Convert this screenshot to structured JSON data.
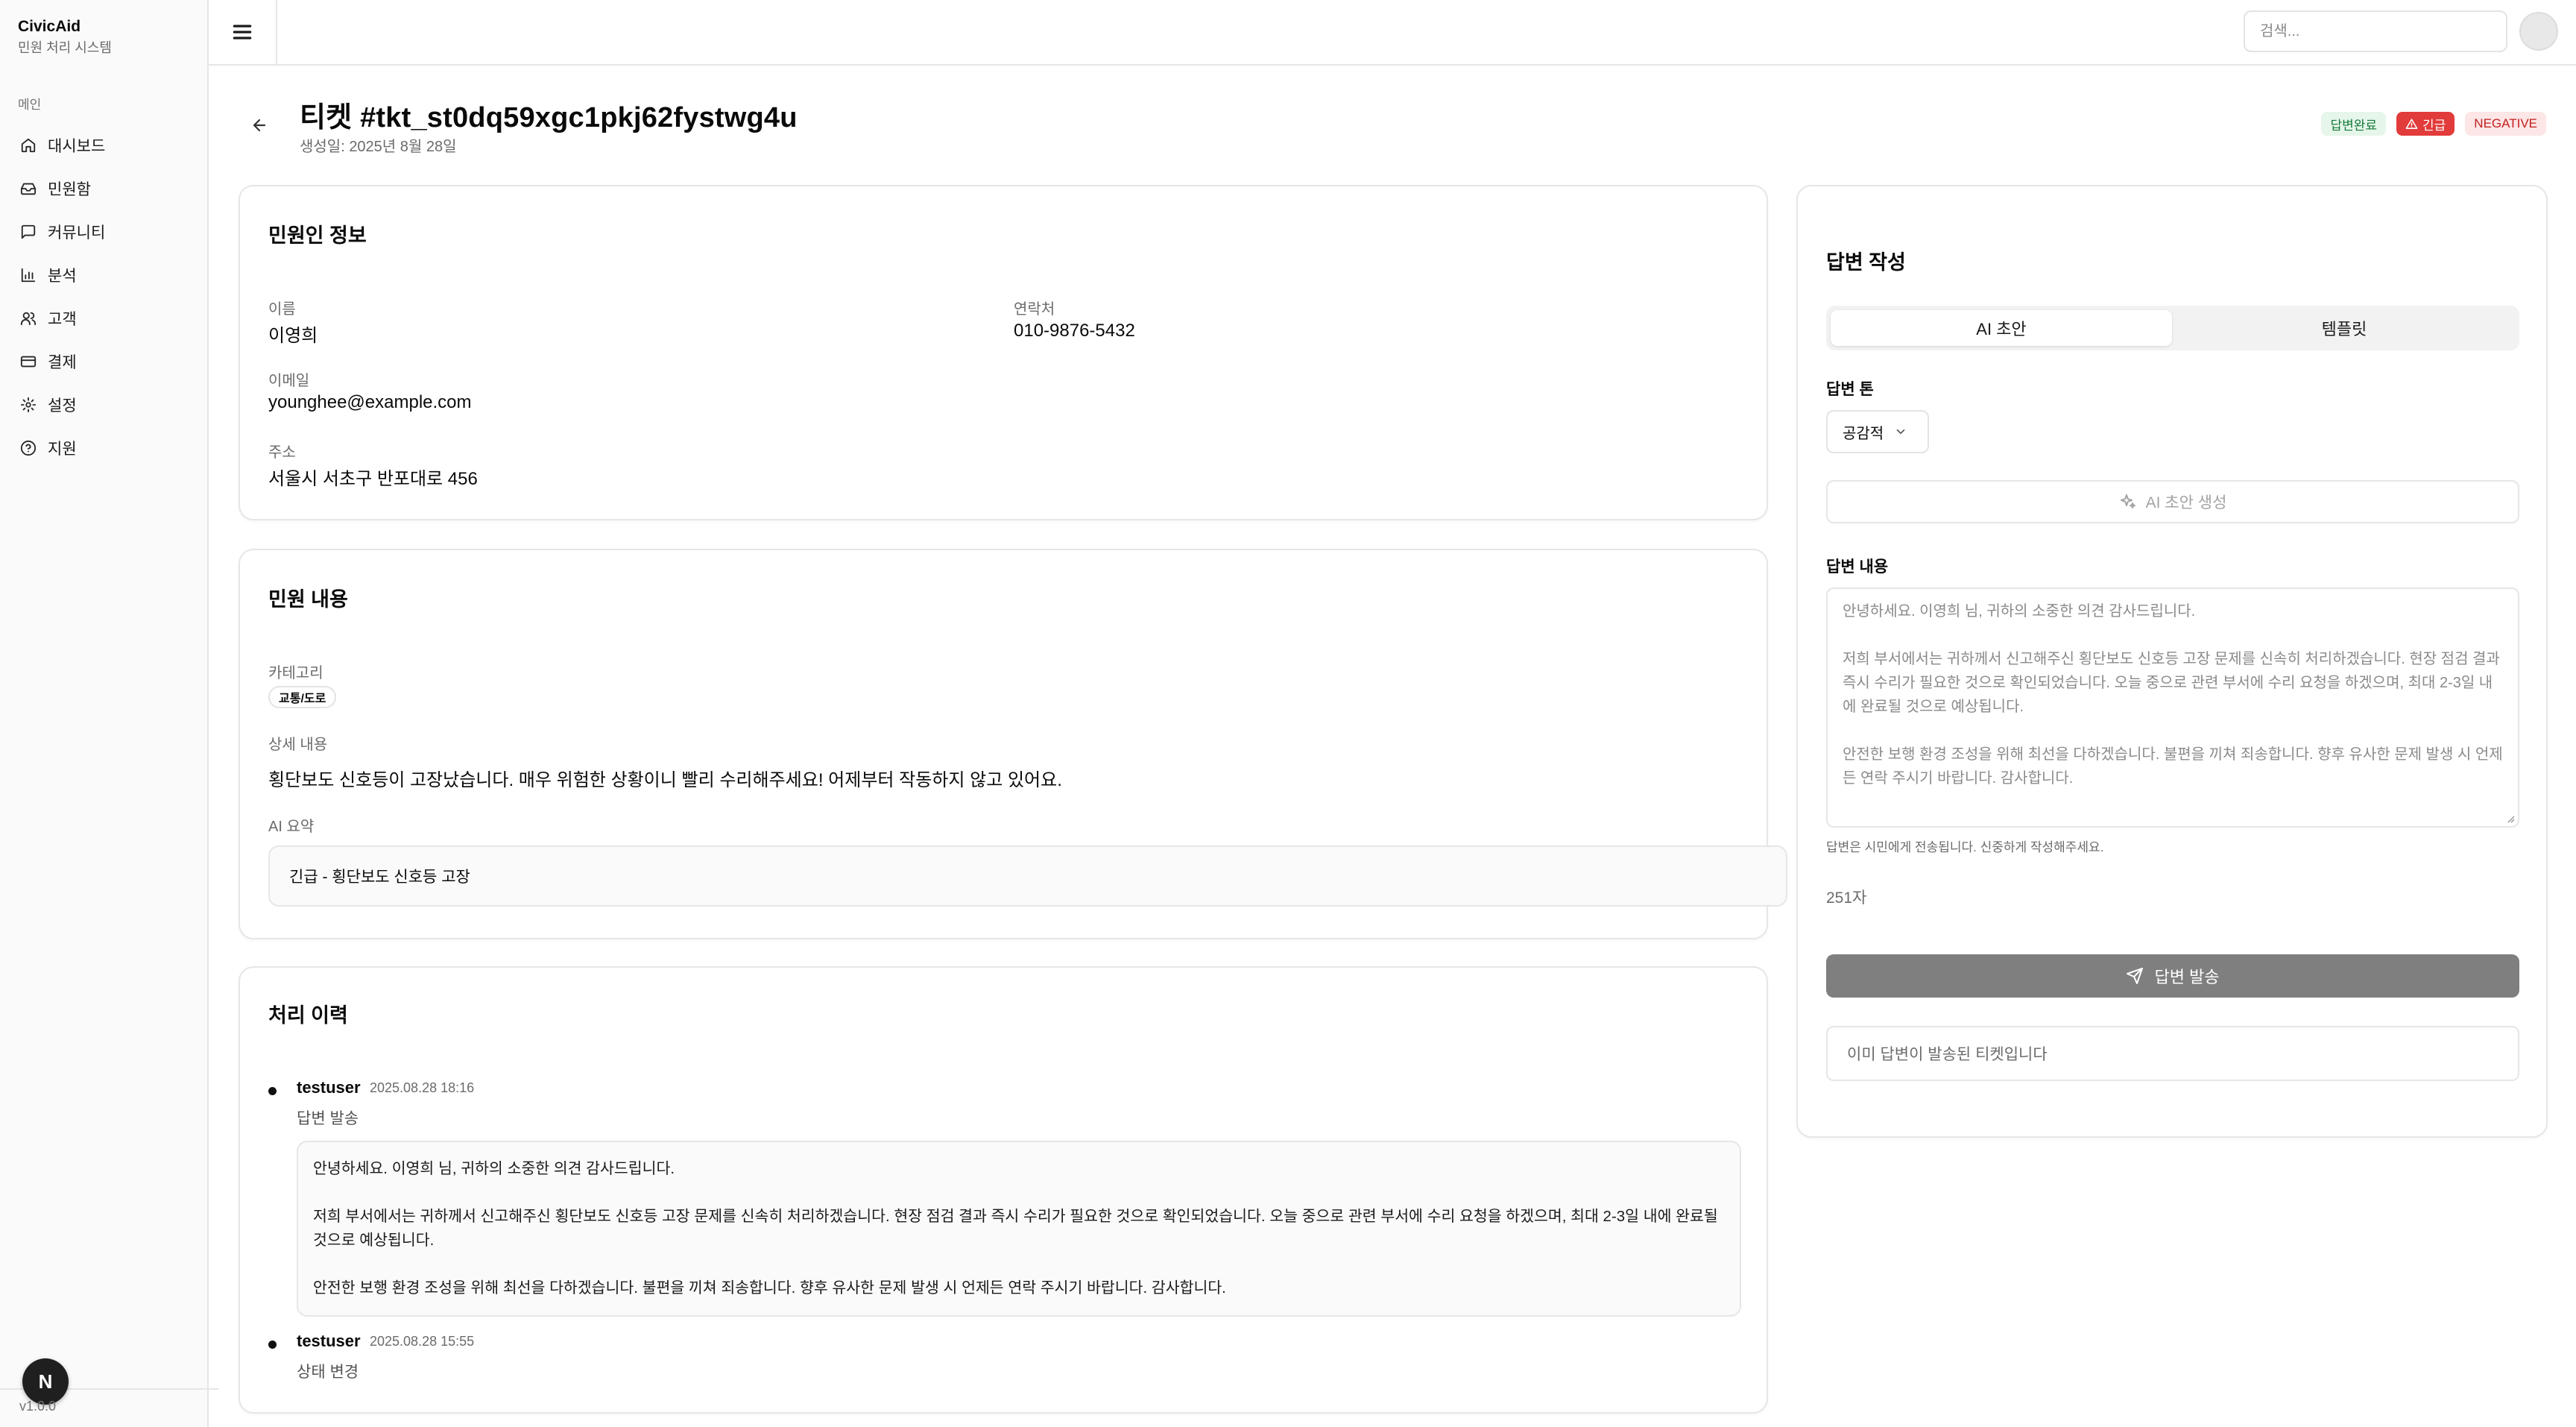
{
  "app": {
    "name": "CivicAid",
    "subtitle": "민원 처리 시스템",
    "version": "v1.0.0",
    "fab_letter": "N"
  },
  "sidebar": {
    "group_label": "메인",
    "items": [
      {
        "label": "대시보드",
        "icon": "home-icon"
      },
      {
        "label": "민원함",
        "icon": "inbox-icon"
      },
      {
        "label": "커뮤니티",
        "icon": "message-icon"
      },
      {
        "label": "분석",
        "icon": "bar-chart-icon"
      },
      {
        "label": "고객",
        "icon": "users-icon"
      },
      {
        "label": "결제",
        "icon": "credit-card-icon"
      },
      {
        "label": "설정",
        "icon": "gear-icon"
      },
      {
        "label": "지원",
        "icon": "help-circle-icon"
      }
    ]
  },
  "header": {
    "search_placeholder": "검색..."
  },
  "ticket": {
    "title": "티켓 #tkt_st0dq59xgc1pkj62fystwg4u",
    "created": "생성일: 2025년 8월 28일",
    "badges": {
      "status": "답변완료",
      "priority": "긴급",
      "sentiment": "NEGATIVE"
    }
  },
  "complainant": {
    "section_title": "민원인 정보",
    "name_label": "이름",
    "name": "이영희",
    "phone_label": "연락처",
    "phone": "010-9876-5432",
    "email_label": "이메일",
    "email": "younghee@example.com",
    "address_label": "주소",
    "address": "서울시 서초구 반포대로 456"
  },
  "complaint": {
    "section_title": "민원 내용",
    "category_label": "카테고리",
    "category": "교통/도로",
    "detail_label": "상세 내용",
    "detail": "횡단보도 신호등이 고장났습니다. 매우 위험한 상황이니 빨리 수리해주세요! 어제부터 작동하지 않고 있어요.",
    "ai_summary_label": "AI 요약",
    "ai_summary": "긴급 - 횡단보도 신호등 고장"
  },
  "history": {
    "section_title": "처리 이력",
    "entries": [
      {
        "user": "testuser",
        "time": "2025.08.28 18:16",
        "action": "답변 발송",
        "message": [
          "안녕하세요. 이영희 님, 귀하의 소중한 의견 감사드립니다.",
          "저희 부서에서는 귀하께서 신고해주신 횡단보도 신호등 고장 문제를 신속히 처리하겠습니다. 현장 점검 결과 즉시 수리가 필요한 것으로 확인되었습니다. 오늘 중으로 관련 부서에 수리 요청을 하겠으며, 최대 2-3일 내에 완료될 것으로 예상됩니다.",
          "안전한 보행 환경 조성을 위해 최선을 다하겠습니다. 불편을 끼쳐 죄송합니다. 향후 유사한 문제 발생 시 언제든 연락 주시기 바랍니다. 감사합니다."
        ]
      },
      {
        "user": "testuser",
        "time": "2025.08.28 15:55",
        "action": "상태 변경"
      }
    ]
  },
  "reply": {
    "section_title": "답변 작성",
    "tabs": [
      "AI 초안",
      "템플릿"
    ],
    "tone_label": "답변 톤",
    "tone_value": "공감적",
    "generate_label": "AI 초안 생성",
    "content_label": "답변 내용",
    "content": [
      "안녕하세요. 이영희 님, 귀하의 소중한 의견 감사드립니다.",
      "저희 부서에서는 귀하께서 신고해주신 횡단보도 신호등 고장 문제를 신속히 처리하겠습니다. 현장 점검 결과 즉시 수리가 필요한 것으로 확인되었습니다. 오늘 중으로 관련 부서에 수리 요청을 하겠으며, 최대 2-3일 내에 완료될 것으로 예상됩니다.",
      "안전한 보행 환경 조성을 위해 최선을 다하겠습니다. 불편을 끼쳐 죄송합니다. 향후 유사한 문제 발생 시 언제든 연락 주시기 바랍니다. 감사합니다."
    ],
    "hint": "답변은 시민에게 전송됩니다. 신중하게 작성해주세요.",
    "char_count": "251자",
    "send_label": "답변 발송",
    "notice": "이미 답변이 발송된 티켓입니다"
  },
  "colors": {
    "urgent": "#e23b3b",
    "done_bg": "#e6f6ea",
    "negative_bg": "#fde6e6",
    "send_disabled": "#7f7f7f"
  }
}
